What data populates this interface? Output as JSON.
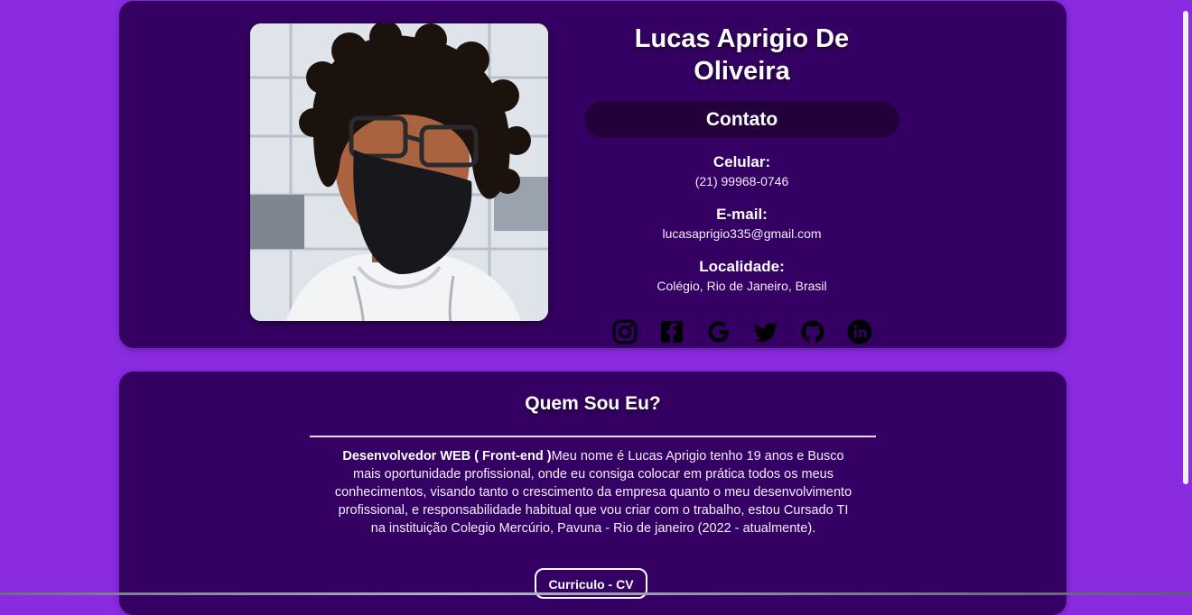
{
  "profile": {
    "name": "Lucas Aprigio De Oliveira",
    "photo_icon": "profile-photo",
    "contact_heading": "Contato",
    "fields": [
      {
        "label": "Celular:",
        "value": "(21) 99968-0746"
      },
      {
        "label": "E-mail:",
        "value": "lucasaprigio335@gmail.com"
      },
      {
        "label": "Localidade:",
        "value": "Colégio, Rio de Janeiro, Brasil"
      }
    ],
    "socials": [
      "instagram-icon",
      "facebook-icon",
      "google-icon",
      "twitter-icon",
      "github-icon",
      "linkedin-icon"
    ]
  },
  "about": {
    "title": "Quem Sou Eu?",
    "bold_lead": "Desenvolvedor WEB ( Front-end )",
    "text": "Meu nome é Lucas Aprigio tenho 19 anos e Busco mais oportunidade profissional, onde eu consiga colocar em prática todos os meus conhecimentos, visando tanto o crescimento da empresa quanto o meu desenvolvimento profissional, e responsabilidade habitual que vou criar com o trabalho, estou Cursado TI na instituição Colegio Mercúrio, Pavuna - Rio de janeiro (2022 - atualmente).",
    "cv_button": "Curriculo - CV"
  },
  "colors": {
    "background": "#8a2be2",
    "card": "#350063",
    "pill": "#21003b",
    "icon": "#000000"
  }
}
